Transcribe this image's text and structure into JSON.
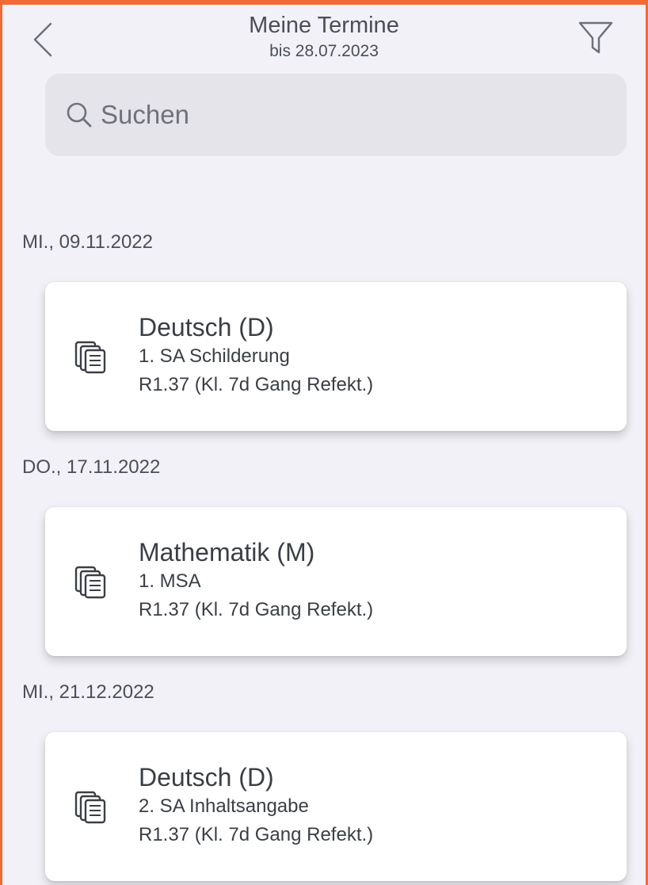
{
  "header": {
    "title": "Meine Termine",
    "subtitle": "bis 28.07.2023"
  },
  "search": {
    "placeholder": "Suchen"
  },
  "colors": {
    "accent": "#f26a35",
    "background": "#f2f1f7",
    "card": "#ffffff",
    "text": "#3a3f45"
  },
  "sections": [
    {
      "date": "MI., 09.11.2022",
      "items": [
        {
          "subject": "Deutsch (D)",
          "title": "1. SA Schilderung",
          "room": "R1.37 (Kl. 7d Gang Refekt.)",
          "icon": "documents-icon"
        }
      ]
    },
    {
      "date": "DO., 17.11.2022",
      "items": [
        {
          "subject": "Mathematik (M)",
          "title": "1. MSA",
          "room": "R1.37 (Kl. 7d Gang Refekt.)",
          "icon": "documents-icon"
        }
      ]
    },
    {
      "date": "MI., 21.12.2022",
      "items": [
        {
          "subject": "Deutsch (D)",
          "title": "2. SA Inhaltsangabe",
          "room": "R1.37 (Kl. 7d Gang Refekt.)",
          "icon": "documents-icon"
        }
      ]
    }
  ]
}
